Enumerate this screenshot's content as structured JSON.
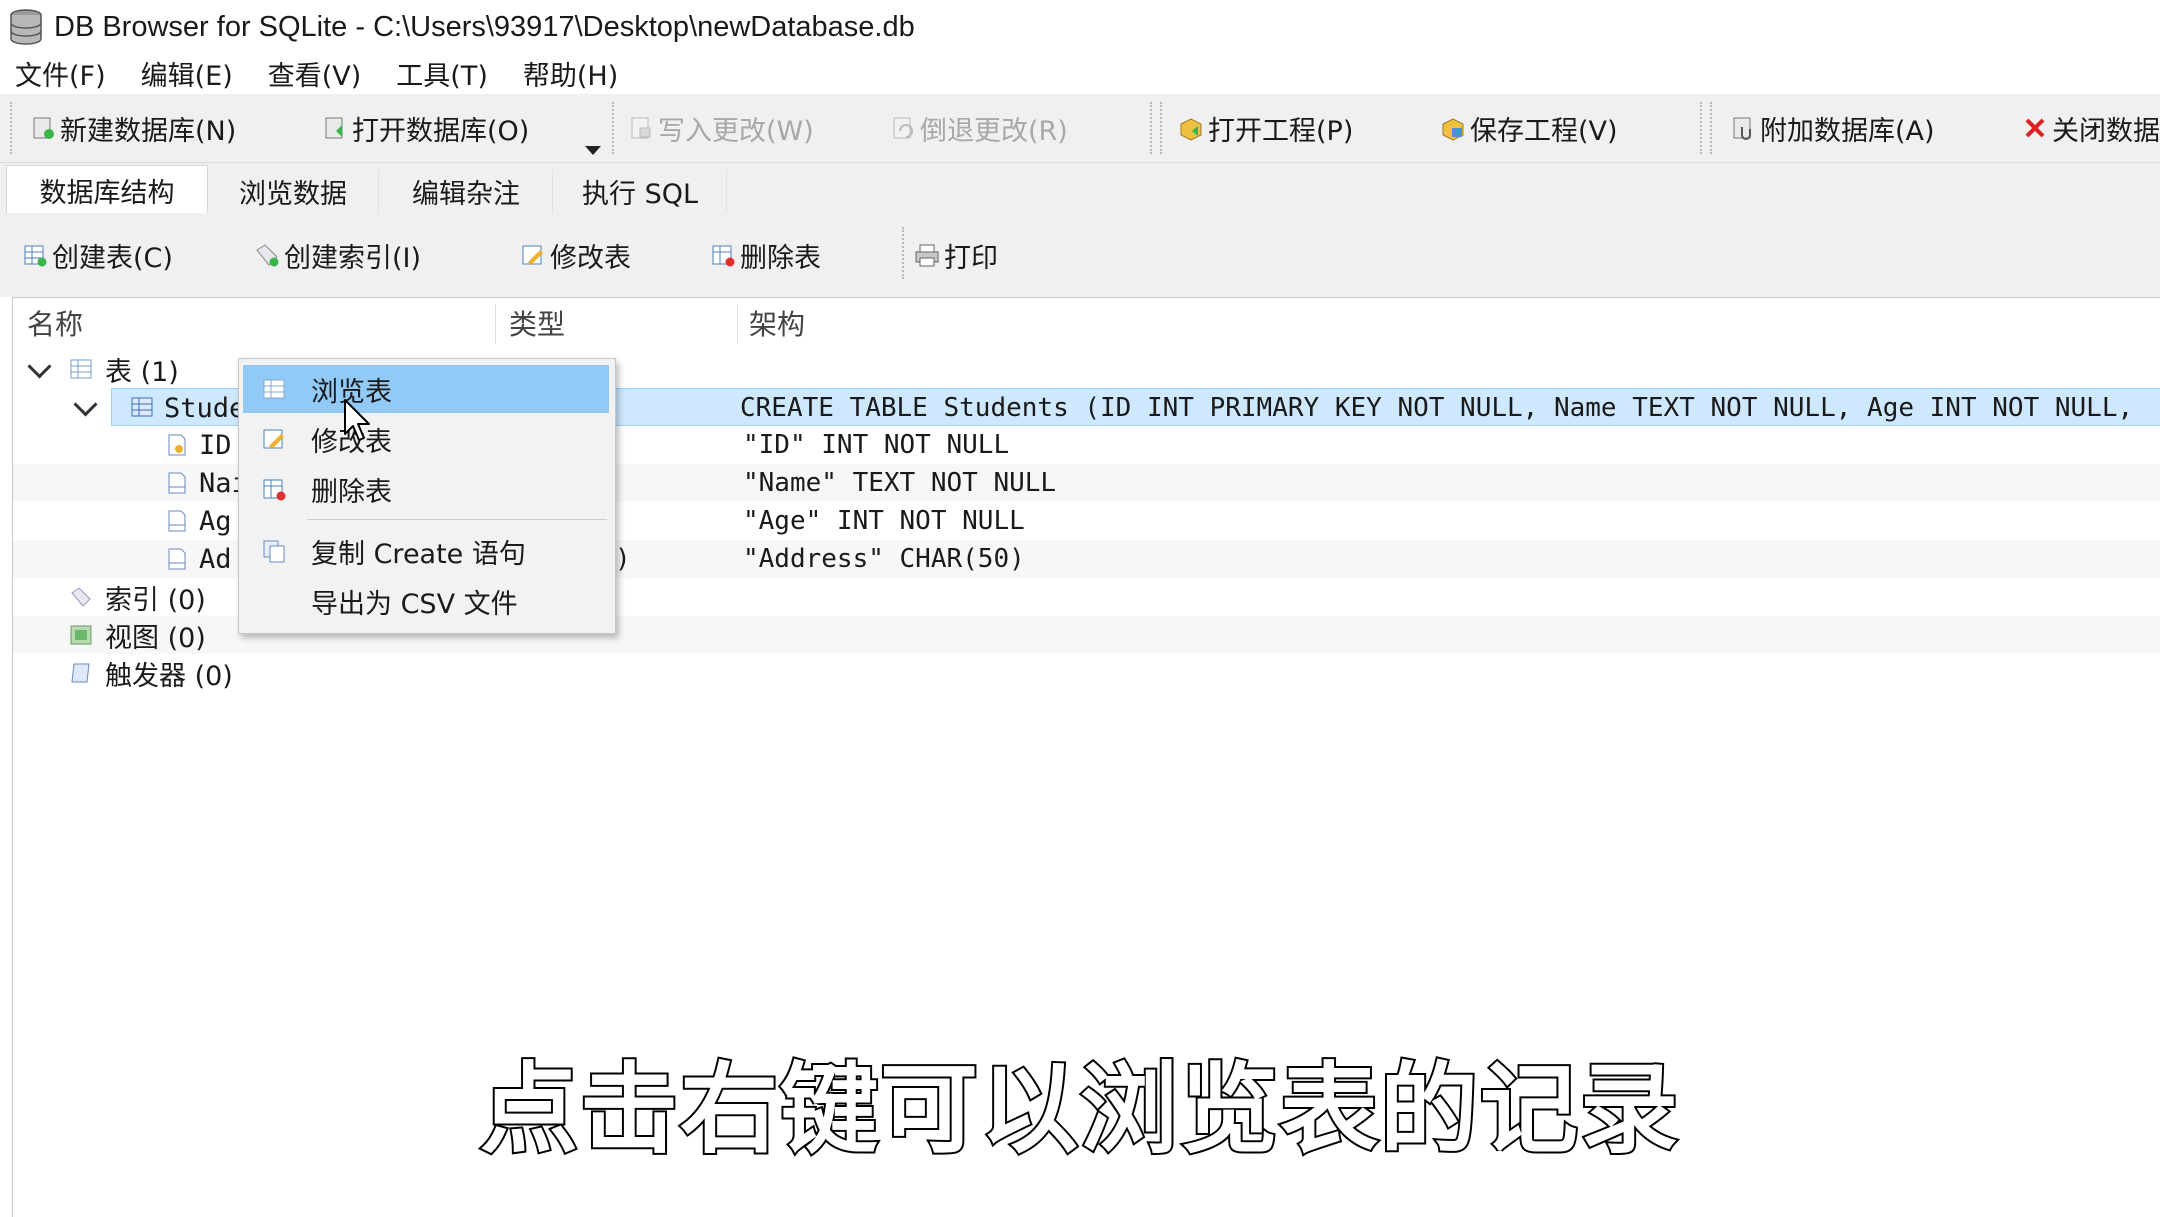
{
  "window": {
    "title": "DB Browser for SQLite - C:\\Users\\93917\\Desktop\\newDatabase.db"
  },
  "menu": [
    "文件(F)",
    "编辑(E)",
    "查看(V)",
    "工具(T)",
    "帮助(H)"
  ],
  "toolbar": {
    "new_db": "新建数据库(N)",
    "open_db": "打开数据库(O)",
    "write_changes": "写入更改(W)",
    "revert_changes": "倒退更改(R)",
    "open_project": "打开工程(P)",
    "save_project": "保存工程(V)",
    "attach_db": "附加数据库(A)",
    "close_db": "关闭数据"
  },
  "tabs": [
    "数据库结构",
    "浏览数据",
    "编辑杂注",
    "执行 SQL"
  ],
  "structure_toolbar": {
    "create_table": "创建表(C)",
    "create_index": "创建索引(I)",
    "modify_table": "修改表",
    "delete_table": "删除表",
    "print": "打印"
  },
  "tree": {
    "headers": {
      "name": "名称",
      "type": "类型",
      "schema": "架构"
    },
    "tables_node": "表 (1)",
    "table_name": "Studer",
    "table_schema": "CREATE TABLE Students (ID INT PRIMARY KEY NOT NULL, Name TEXT NOT NULL, Age INT NOT NULL,",
    "fields": [
      {
        "name": "ID",
        "schema": "\"ID\" INT NOT NULL"
      },
      {
        "name": "Nai",
        "schema": "\"Name\" TEXT NOT NULL"
      },
      {
        "name": "Ag",
        "schema": "\"Age\" INT NOT NULL"
      },
      {
        "name": "Ad",
        "schema": "\"Address\" CHAR(50)",
        "type_fragment": ")"
      }
    ],
    "indexes_node": "索引 (0)",
    "views_node": "视图 (0)",
    "triggers_node": "触发器 (0)"
  },
  "context_menu": {
    "browse": "浏览表",
    "modify": "修改表",
    "delete": "删除表",
    "copy_create": "复制 Create 语句",
    "export_csv": "导出为 CSV 文件"
  },
  "subtitle": "点击右键可以浏览表的记录",
  "colors": {
    "selection": "#cde8ff",
    "menu_highlight": "#91c9f7",
    "close_red": "#e02020"
  }
}
